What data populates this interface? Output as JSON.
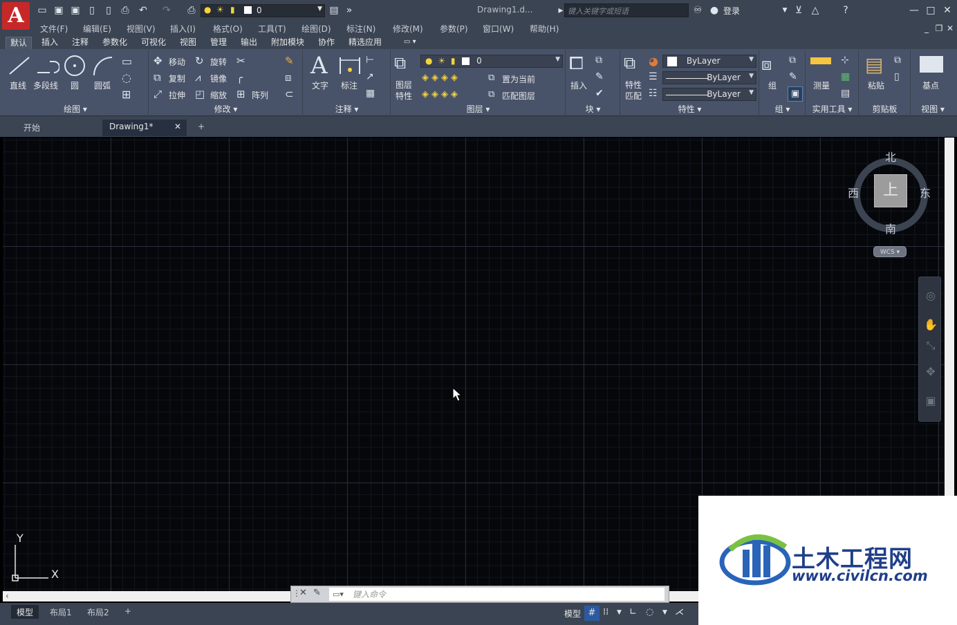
{
  "titlebar": {
    "logo": "A",
    "layer_value": "0",
    "doc_title": "Drawing1.d...",
    "search_placeholder": "键入关键字或短语",
    "login": "登录"
  },
  "menu": [
    "文件(F)",
    "编辑(E)",
    "视图(V)",
    "插入(I)",
    "格式(O)",
    "工具(T)",
    "绘图(D)",
    "标注(N)",
    "修改(M)",
    "参数(P)",
    "窗口(W)",
    "帮助(H)"
  ],
  "ribbon_tabs": [
    "默认",
    "插入",
    "注释",
    "参数化",
    "可视化",
    "视图",
    "管理",
    "输出",
    "附加模块",
    "协作",
    "精选应用"
  ],
  "ribbon": {
    "draw": {
      "label": "绘图",
      "line": "直线",
      "polyline": "多段线",
      "circle": "圆",
      "arc": "圆弧"
    },
    "modify": {
      "label": "修改",
      "move": "移动",
      "rotate": "旋转",
      "copy": "复制",
      "mirror": "镜像",
      "stretch": "拉伸",
      "scale": "缩放",
      "array": "阵列"
    },
    "annotation": {
      "label": "注释",
      "text": "文字",
      "dimension": "标注"
    },
    "layers": {
      "label": "图层",
      "properties": "图层\n特性",
      "layer_value": "0",
      "set_current": "置为当前",
      "match_layer": "匹配图层"
    },
    "block": {
      "label": "块",
      "insert": "插入"
    },
    "properties": {
      "label": "特性",
      "match": "特性\n匹配",
      "color": "ByLayer",
      "linetype": "ByLayer",
      "lineweight": "ByLayer"
    },
    "groups": {
      "label": "组",
      "group": "组"
    },
    "utilities": {
      "label": "实用工具",
      "measure": "测量"
    },
    "clipboard": {
      "label": "剪贴板",
      "paste": "粘贴"
    },
    "view": {
      "label": "视图",
      "base": "基点"
    }
  },
  "file_tabs": [
    "开始",
    "Drawing1*"
  ],
  "viewcube": {
    "north": "北",
    "south": "南",
    "east": "东",
    "west": "西",
    "face": "上",
    "wcs": "WCS"
  },
  "ucs": {
    "x": "X",
    "y": "Y"
  },
  "command": {
    "placeholder": "键入命令"
  },
  "status": {
    "layout_tabs": [
      "模型",
      "布局1",
      "布局2"
    ],
    "model": "模型"
  },
  "watermark": {
    "title": "土木工程网",
    "url": "www.civilcn.com"
  }
}
